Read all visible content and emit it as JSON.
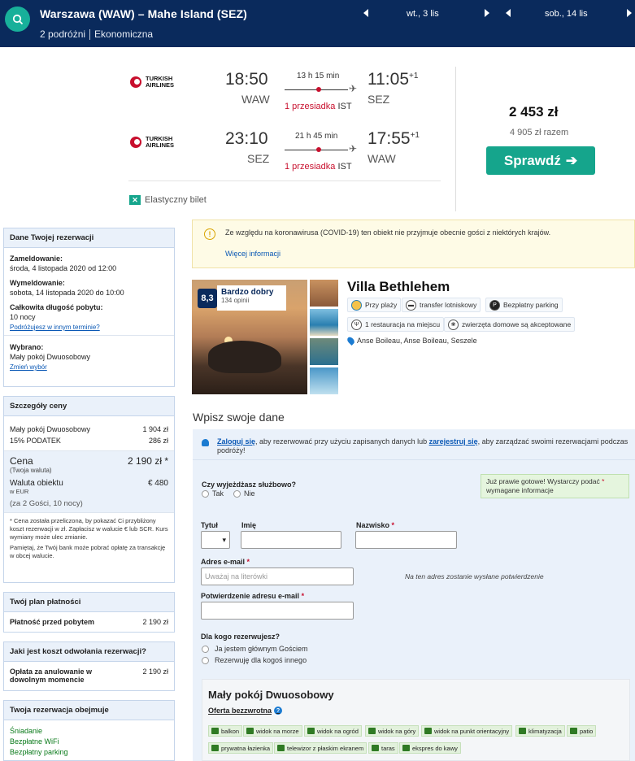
{
  "header": {
    "route": "Warszawa (WAW) – Mahe Island (SEZ)",
    "travelers": "2 podróżni",
    "cabin": "Ekonomiczna",
    "depart_date": "wt., 3 lis",
    "return_date": "sob., 14 lis"
  },
  "flight": {
    "airline_name_line1": "TURKISH",
    "airline_name_line2": "AIRLINES",
    "outbound": {
      "dep_time": "18:50",
      "dep_code": "WAW",
      "duration": "13 h 15 min",
      "stops": "1 przesiadka",
      "via": "IST",
      "arr_time": "11:05",
      "arr_offset": "+1",
      "arr_code": "SEZ"
    },
    "inbound": {
      "dep_time": "23:10",
      "dep_code": "SEZ",
      "duration": "21 h 45 min",
      "stops": "1 przesiadka",
      "via": "IST",
      "arr_time": "17:55",
      "arr_offset": "+1",
      "arr_code": "WAW"
    },
    "price": "2 453 zł",
    "price_total": "4 905 zł razem",
    "check_button": "Sprawdź",
    "flex_ticket": "Elastyczny bilet"
  },
  "sidebar": {
    "booking": {
      "title": "Dane Twojej rezerwacji",
      "checkin_label": "Zameldowanie:",
      "checkin_value": "środa, 4 listopada 2020 od 12:00",
      "checkout_label": "Wymeldowanie:",
      "checkout_value": "sobota, 14 listopada 2020 do 10:00",
      "length_label": "Całkowita długość pobytu:",
      "length_value": "10 nocy",
      "other_date_link": "Podróżujesz w innym terminie?",
      "chosen_label": "Wybrano:",
      "chosen_value": "Mały pokój Dwuosobowy",
      "change_link": "Zmień wybór"
    },
    "price": {
      "title": "Szczegóły ceny",
      "row1_label": "Mały pokój Dwuosobowy",
      "row1_value": "1 904 zł",
      "row2_label": "15% PODATEK",
      "row2_value": "286 zł",
      "total_label": "Cena",
      "total_sub": "(Twoja waluta)",
      "total_value": "2 190 zł *",
      "prop_label": "Waluta obiektu",
      "prop_sub": "w EUR",
      "prop_value": "€ 480",
      "guests_note": "(za 2 Gości, 10 nocy)",
      "footnote1": "* Cena została przeliczona, by pokazać Ci przybliżony koszt rezerwacji w zł. Zapłacisz w walucie € lub SCR. Kurs wymiany może ulec zmianie.",
      "footnote2": "Pamiętaj, że Twój bank może pobrać opłatę za transakcję w obcej walucie."
    },
    "plan": {
      "title": "Twój plan płatności",
      "label": "Płatność przed pobytem",
      "value": "2 190 zł"
    },
    "cancel": {
      "title": "Jaki jest koszt odwołania rezerwacji?",
      "label": "Opłata za anulowanie w dowolnym momencie",
      "value": "2 190 zł"
    },
    "includes": {
      "title": "Twoja rezerwacja obejmuje",
      "items": [
        "Śniadanie",
        "Bezpłatne WiFi",
        "Bezpłatny parking"
      ]
    }
  },
  "covid": {
    "text": "Ze względu na koronawirusa (COVID-19) ten obiekt nie przyjmuje obecnie gości z niektórych krajów.",
    "link": "Więcej informacji"
  },
  "hotel": {
    "score": "8,3",
    "rating_word": "Bardzo dobry",
    "reviews": "134 opinii",
    "name": "Villa Bethlehem",
    "features": [
      "Przy plaży",
      "transfer lotniskowy",
      "Bezpłatny parking",
      "1 restauracja na miejscu",
      "zwierzęta domowe są akceptowane"
    ],
    "address": "Anse Boileau, Anse Boileau, Seszele"
  },
  "form": {
    "title": "Wpisz swoje dane",
    "login_link": "Zaloguj się",
    "login_text_mid": ", aby rezerwować przy użyciu zapisanych danych lub ",
    "register_link": "zarejestruj się",
    "login_text_end": ", aby zarządzać swoimi rezerwacjami podczas podróży!",
    "business_q": "Czy wyjeżdżasz służbowo?",
    "yes": "Tak",
    "no": "Nie",
    "almost_done": "Już prawie gotowe! Wystarczy podać",
    "almost_done_2": "wymagane informacje",
    "title_label": "Tytuł",
    "first_label": "Imię",
    "last_label": "Nazwisko",
    "email_label": "Adres e-mail",
    "email_placeholder": "Uważaj na literówki",
    "email_hint": "Na ten adres zostanie wysłane potwierdzenie",
    "confirm_label": "Potwierdzenie adresu e-mail",
    "for_whom": "Dla kogo rezerwujesz?",
    "opt1": "Ja jestem głównym Gościem",
    "opt2": "Rezerwuję dla kogoś innego",
    "room_title": "Mały pokój Dwuosobowy",
    "offer": "Oferta bezzwrotna",
    "facilities": [
      "balkon",
      "widok na morze",
      "widok na ogród",
      "widok na góry",
      "widok na punkt orientacyjny",
      "klimatyzacja",
      "patio",
      "prywatna łazienka",
      "telewizor z płaskim ekranem",
      "taras",
      "ekspres do kawy"
    ]
  },
  "colors": {
    "navy": "#0a2a5c",
    "teal": "#15a58c",
    "red": "#c8102e",
    "link": "#0a58b5"
  }
}
